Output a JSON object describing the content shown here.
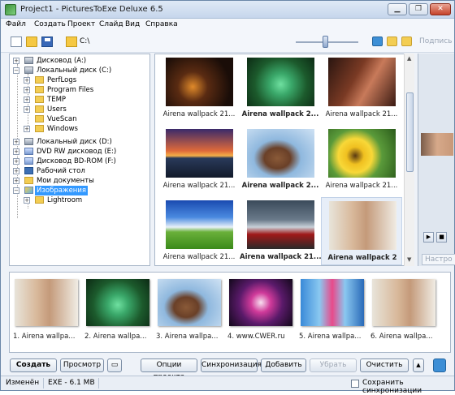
{
  "window": {
    "title": "Project1 - PicturesToExe Deluxe 6.5",
    "controls": [
      "minimize-icon",
      "restore-icon",
      "close-icon"
    ]
  },
  "menu": [
    "Файл",
    "Создать",
    "Проект",
    "Слайд",
    "Вид",
    "Справка"
  ],
  "toolbar": {
    "path": "C:\\",
    "caption_label": "Подпись",
    "icons": [
      "new-file-icon",
      "open-folder-icon",
      "save-icon",
      "browse-folder-icon",
      "zoom-slider",
      "view-icon",
      "folder-up-icon",
      "folder-new-icon"
    ]
  },
  "tree": [
    {
      "label": "Дисковод (A:)",
      "icon": "floppy-drive-icon"
    },
    {
      "label": "Локальный диск (C:)",
      "icon": "hard-drive-icon"
    },
    {
      "label": "PerfLogs",
      "icon": "folder-icon"
    },
    {
      "label": "Program Files",
      "icon": "folder-icon"
    },
    {
      "label": "TEMP",
      "icon": "folder-icon"
    },
    {
      "label": "Users",
      "icon": "folder-icon"
    },
    {
      "label": "VueScan",
      "icon": "folder-icon"
    },
    {
      "label": "Windows",
      "icon": "folder-icon"
    },
    {
      "label": "Локальный диск (D:)",
      "icon": "hard-drive-icon"
    },
    {
      "label": "DVD RW дисковод (E:)",
      "icon": "dvd-drive-icon"
    },
    {
      "label": "Дисковод BD-ROM (F:)",
      "icon": "dvd-drive-icon"
    },
    {
      "label": "Рабочий стол",
      "icon": "desktop-icon"
    },
    {
      "label": "Мои документы",
      "icon": "documents-icon"
    },
    {
      "label": "Изображения",
      "icon": "pictures-icon",
      "selected": true
    },
    {
      "label": "Lightroom",
      "icon": "folder-icon"
    }
  ],
  "files": [
    {
      "label": "Airena wallpack 21...",
      "bold": false
    },
    {
      "label": "Airena wallpack 2...",
      "bold": true
    },
    {
      "label": "Airena wallpack 21...",
      "bold": false
    },
    {
      "label": "Airena wallpack 21...",
      "bold": false
    },
    {
      "label": "Airena wallpack 2...",
      "bold": true
    },
    {
      "label": "Airena wallpack 21...",
      "bold": false
    },
    {
      "label": "Airena wallpack 21...",
      "bold": false
    },
    {
      "label": "Airena wallpack 21...",
      "bold": false
    },
    {
      "label": "Airena wallpack 2",
      "bold": true,
      "selected": true
    }
  ],
  "slides": [
    "1. Airena wallpa...",
    "2. Airena wallpa...",
    "3. Airena wallpa...",
    "4. www.CWER.ru",
    "5. Airena wallpa...",
    "6. Airena wallpa..."
  ],
  "preview": {
    "settings_label": "Настро"
  },
  "buttons": {
    "create": "Создать",
    "preview": "Просмотр",
    "project_options": "Опции проекта",
    "sync": "Синхронизация",
    "add": "Добавить",
    "remove": "Убрать",
    "clear": "Очистить"
  },
  "status": {
    "modified": "Изменён",
    "exe": "EXE - 6.1 MB",
    "save_sync": "Сохранить синхронизации"
  }
}
